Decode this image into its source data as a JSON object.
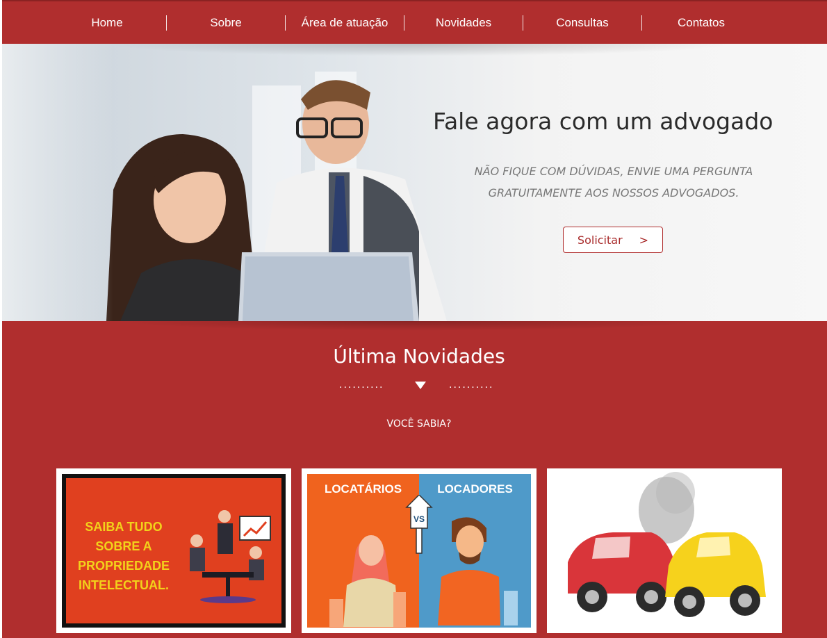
{
  "nav": {
    "items": [
      {
        "label": "Home"
      },
      {
        "label": "Sobre"
      },
      {
        "label": "Área de atuação"
      },
      {
        "label": "Novidades"
      },
      {
        "label": "Consultas"
      },
      {
        "label": "Contatos"
      }
    ]
  },
  "hero": {
    "title": "Fale agora com um advogado",
    "subtitle_line1": "NÃO FIQUE COM DÚVIDAS, ENVIE UMA PERGUNTA",
    "subtitle_line2": "GRATUITAMENTE AOS NOSSOS ADVOGADOS.",
    "button_label": "Solicitar",
    "button_arrow": ">"
  },
  "news": {
    "title": "Última Novidades",
    "kicker": "VOCÊ SABIA?",
    "dots": "..........",
    "cards": [
      {
        "text_lines": [
          "SAIBA TUDO",
          "SOBRE A",
          "PROPRIEDADE",
          "INTELECTUAL."
        ]
      },
      {
        "left_label": "LOCATÁRIOS",
        "right_label": "LOCADORES",
        "vs": "VS"
      },
      {}
    ]
  },
  "colors": {
    "brand_red": "#b02e2e",
    "card1_bg": "#e0401f",
    "card1_text": "#f2d21b",
    "card2_left": "#f0631e",
    "card2_right": "#4f9ac9"
  }
}
